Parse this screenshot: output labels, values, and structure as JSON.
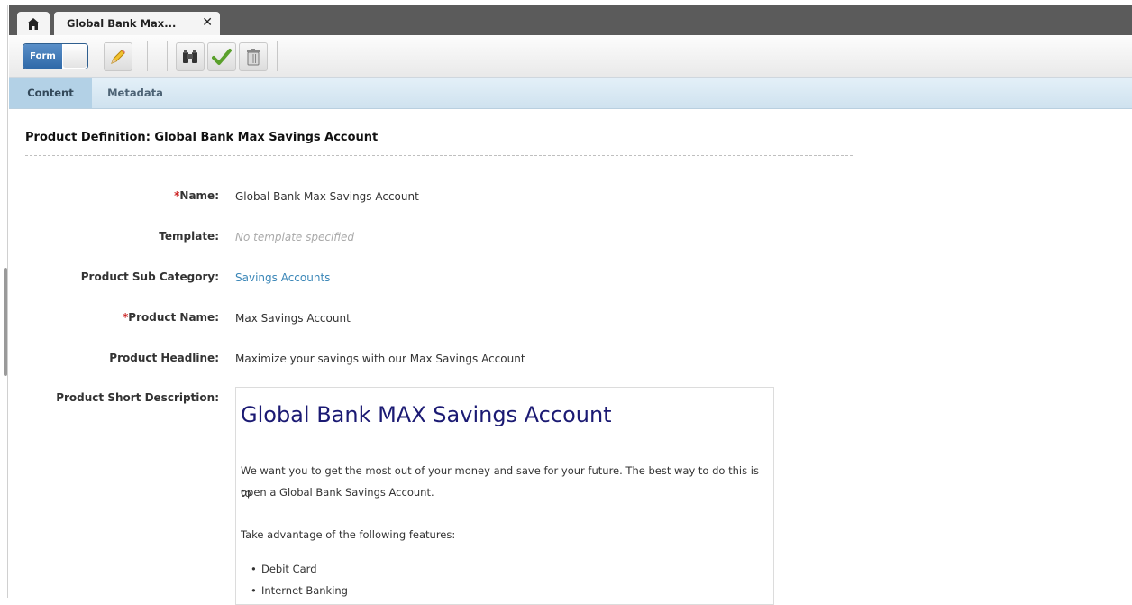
{
  "tabs": {
    "home_icon": "home-icon",
    "document_tab_title": "Global Bank Max...",
    "close_glyph": "✕"
  },
  "toolbar": {
    "form_toggle_label": "Form",
    "icons": [
      "pencil-icon",
      "binoculars-icon",
      "checkmark-icon",
      "trash-icon"
    ]
  },
  "subtabs": [
    {
      "label": "Content",
      "active": true
    },
    {
      "label": "Metadata",
      "active": false
    }
  ],
  "page": {
    "heading": "Product Definition: Global Bank Max Savings Account"
  },
  "fields": [
    {
      "label": "Name:",
      "required": true,
      "value": "Global Bank Max Savings Account"
    },
    {
      "label": "Template:",
      "required": false,
      "value": "No template specified"
    },
    {
      "label": "Product Sub Category:",
      "required": false,
      "value": "Savings Accounts"
    },
    {
      "label": "Product Name:",
      "required": true,
      "value": "Max Savings Account"
    },
    {
      "label": "Product Headline:",
      "required": false,
      "value": "Maximize your savings with our Max Savings Account"
    },
    {
      "label": "Product Short Description:",
      "required": false
    }
  ],
  "required_marker": "*",
  "description": {
    "title": "Global Bank MAX Savings Account",
    "paragraph1_line1": "We want you to get the most out of your money and save for your future. The best way to do this is to",
    "paragraph1_line2": "open a Global Bank Savings Account.",
    "paragraph2": "Take advantage of the following features:",
    "features": [
      "Debit Card",
      "Internet Banking"
    ]
  },
  "colors": {
    "tab_bar": "#5b5b5b",
    "subtab_active": "#b3d1e6",
    "required": "#cc2222",
    "link": "#3a86b7",
    "description_title": "#1b1a73"
  }
}
